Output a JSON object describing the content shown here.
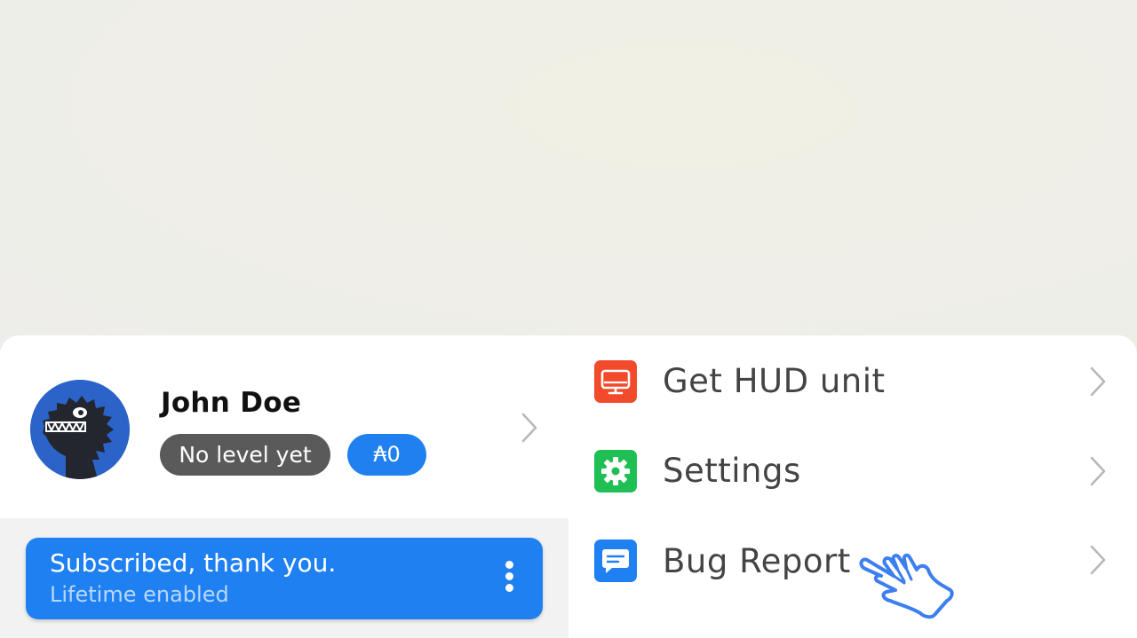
{
  "profile": {
    "name": "John Doe",
    "level": "No level yet",
    "coins": "₳0"
  },
  "subscription": {
    "title": "Subscribed, thank you.",
    "subtitle": "Lifetime enabled"
  },
  "menu": {
    "items": [
      {
        "label": "Get HUD unit",
        "icon": "monitor-icon",
        "color": "#f24b2c"
      },
      {
        "label": "Settings",
        "icon": "gear-icon",
        "color": "#1fbf54"
      },
      {
        "label": "Bug Report",
        "icon": "chat-bubble-icon",
        "color": "#1f80f2"
      }
    ]
  },
  "colors": {
    "accent": "#1f80f2",
    "badge_gray": "#5a5a5a",
    "avatar_bg": "#2b63c9"
  }
}
